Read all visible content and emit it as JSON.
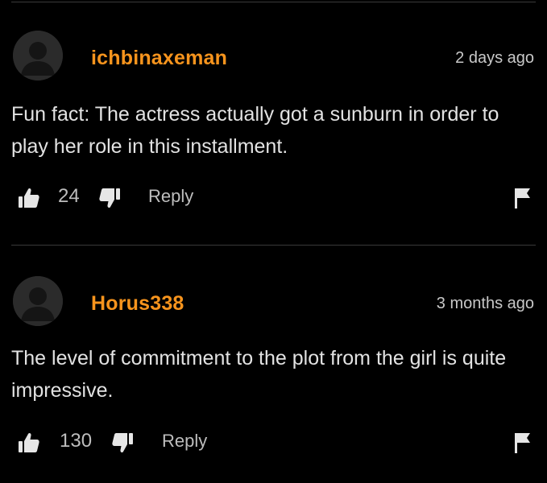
{
  "comments": [
    {
      "username": "ichbinaxeman",
      "timestamp": "2 days ago",
      "text": "Fun fact: The actress actually got a sunburn in order to play her role in this installment.",
      "likes": "24",
      "reply_label": "Reply"
    },
    {
      "username": "Horus338",
      "timestamp": "3 months ago",
      "text": "The level of commitment to the plot from the girl is quite impressive.",
      "likes": "130",
      "reply_label": "Reply"
    }
  ],
  "colors": {
    "background": "#000000",
    "username": "#f7941d",
    "text": "#e2e2e2",
    "muted": "#bdbdbd",
    "divider": "#3a3a3a"
  },
  "icons": [
    "avatar-icon",
    "thumbs-up-icon",
    "thumbs-down-icon",
    "flag-icon"
  ]
}
